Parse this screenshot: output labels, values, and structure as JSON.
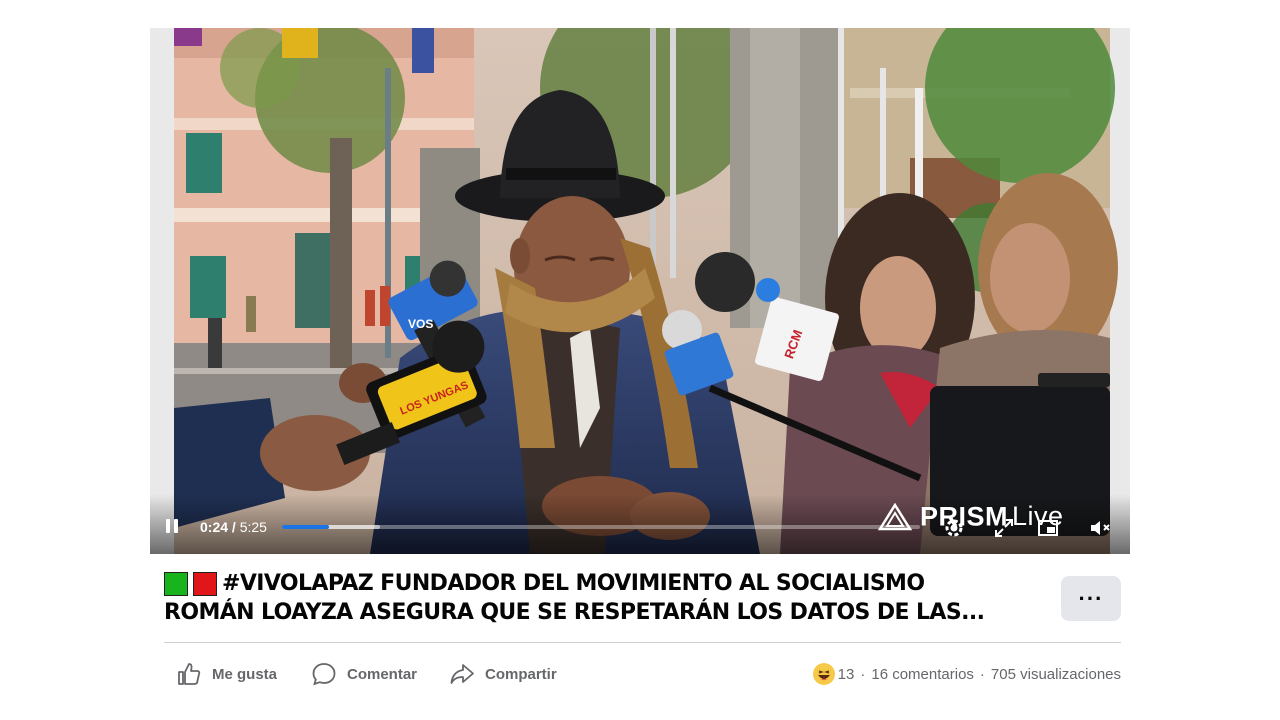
{
  "video": {
    "current_time": "0:24",
    "duration": "5:25",
    "played_fraction": 0.074,
    "buffered_fraction": 0.153,
    "watermark_brand": "PRISM",
    "watermark_suffix": "Live",
    "mic_labels": [
      "VOS",
      "LOS YUNGAS",
      "RCM"
    ]
  },
  "post": {
    "badge_colors": [
      "#19b31e",
      "#e0161b"
    ],
    "title_line1": "#VIVOLAPAZ FUNDADOR DEL MOVIMIENTO AL SOCIALISMO",
    "title_line2": "ROMÁN LOAYZA ASEGURA QUE SE RESPETARÁN LOS DATOS DE LAS...",
    "more_label": "···"
  },
  "actions": {
    "like_label": "Me gusta",
    "comment_label": "Comentar",
    "share_label": "Compartir"
  },
  "stats": {
    "reaction_count": "13",
    "sep": "·",
    "comments": "16 comentarios",
    "views": "705 visualizaciones"
  },
  "colors": {
    "accent": "#1b74e4",
    "secondary_text": "#65676b",
    "button_bg": "#e4e6eb"
  }
}
